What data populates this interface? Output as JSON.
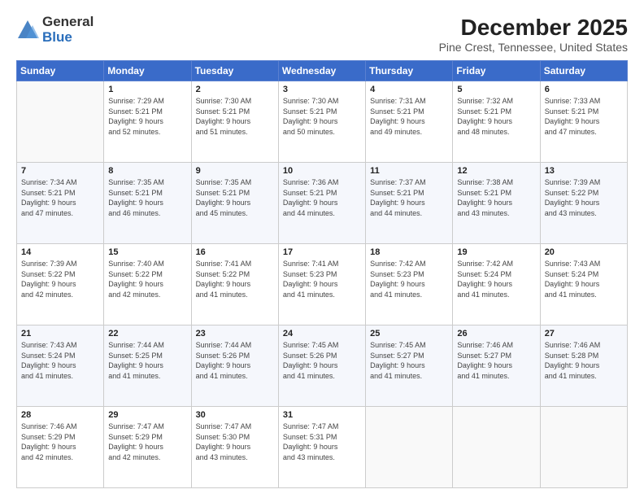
{
  "logo": {
    "general": "General",
    "blue": "Blue"
  },
  "title": "December 2025",
  "subtitle": "Pine Crest, Tennessee, United States",
  "headers": [
    "Sunday",
    "Monday",
    "Tuesday",
    "Wednesday",
    "Thursday",
    "Friday",
    "Saturday"
  ],
  "weeks": [
    [
      {
        "day": "",
        "info": ""
      },
      {
        "day": "1",
        "info": "Sunrise: 7:29 AM\nSunset: 5:21 PM\nDaylight: 9 hours\nand 52 minutes."
      },
      {
        "day": "2",
        "info": "Sunrise: 7:30 AM\nSunset: 5:21 PM\nDaylight: 9 hours\nand 51 minutes."
      },
      {
        "day": "3",
        "info": "Sunrise: 7:30 AM\nSunset: 5:21 PM\nDaylight: 9 hours\nand 50 minutes."
      },
      {
        "day": "4",
        "info": "Sunrise: 7:31 AM\nSunset: 5:21 PM\nDaylight: 9 hours\nand 49 minutes."
      },
      {
        "day": "5",
        "info": "Sunrise: 7:32 AM\nSunset: 5:21 PM\nDaylight: 9 hours\nand 48 minutes."
      },
      {
        "day": "6",
        "info": "Sunrise: 7:33 AM\nSunset: 5:21 PM\nDaylight: 9 hours\nand 47 minutes."
      }
    ],
    [
      {
        "day": "7",
        "info": "Sunrise: 7:34 AM\nSunset: 5:21 PM\nDaylight: 9 hours\nand 47 minutes."
      },
      {
        "day": "8",
        "info": "Sunrise: 7:35 AM\nSunset: 5:21 PM\nDaylight: 9 hours\nand 46 minutes."
      },
      {
        "day": "9",
        "info": "Sunrise: 7:35 AM\nSunset: 5:21 PM\nDaylight: 9 hours\nand 45 minutes."
      },
      {
        "day": "10",
        "info": "Sunrise: 7:36 AM\nSunset: 5:21 PM\nDaylight: 9 hours\nand 44 minutes."
      },
      {
        "day": "11",
        "info": "Sunrise: 7:37 AM\nSunset: 5:21 PM\nDaylight: 9 hours\nand 44 minutes."
      },
      {
        "day": "12",
        "info": "Sunrise: 7:38 AM\nSunset: 5:21 PM\nDaylight: 9 hours\nand 43 minutes."
      },
      {
        "day": "13",
        "info": "Sunrise: 7:39 AM\nSunset: 5:22 PM\nDaylight: 9 hours\nand 43 minutes."
      }
    ],
    [
      {
        "day": "14",
        "info": "Sunrise: 7:39 AM\nSunset: 5:22 PM\nDaylight: 9 hours\nand 42 minutes."
      },
      {
        "day": "15",
        "info": "Sunrise: 7:40 AM\nSunset: 5:22 PM\nDaylight: 9 hours\nand 42 minutes."
      },
      {
        "day": "16",
        "info": "Sunrise: 7:41 AM\nSunset: 5:22 PM\nDaylight: 9 hours\nand 41 minutes."
      },
      {
        "day": "17",
        "info": "Sunrise: 7:41 AM\nSunset: 5:23 PM\nDaylight: 9 hours\nand 41 minutes."
      },
      {
        "day": "18",
        "info": "Sunrise: 7:42 AM\nSunset: 5:23 PM\nDaylight: 9 hours\nand 41 minutes."
      },
      {
        "day": "19",
        "info": "Sunrise: 7:42 AM\nSunset: 5:24 PM\nDaylight: 9 hours\nand 41 minutes."
      },
      {
        "day": "20",
        "info": "Sunrise: 7:43 AM\nSunset: 5:24 PM\nDaylight: 9 hours\nand 41 minutes."
      }
    ],
    [
      {
        "day": "21",
        "info": "Sunrise: 7:43 AM\nSunset: 5:24 PM\nDaylight: 9 hours\nand 41 minutes."
      },
      {
        "day": "22",
        "info": "Sunrise: 7:44 AM\nSunset: 5:25 PM\nDaylight: 9 hours\nand 41 minutes."
      },
      {
        "day": "23",
        "info": "Sunrise: 7:44 AM\nSunset: 5:26 PM\nDaylight: 9 hours\nand 41 minutes."
      },
      {
        "day": "24",
        "info": "Sunrise: 7:45 AM\nSunset: 5:26 PM\nDaylight: 9 hours\nand 41 minutes."
      },
      {
        "day": "25",
        "info": "Sunrise: 7:45 AM\nSunset: 5:27 PM\nDaylight: 9 hours\nand 41 minutes."
      },
      {
        "day": "26",
        "info": "Sunrise: 7:46 AM\nSunset: 5:27 PM\nDaylight: 9 hours\nand 41 minutes."
      },
      {
        "day": "27",
        "info": "Sunrise: 7:46 AM\nSunset: 5:28 PM\nDaylight: 9 hours\nand 41 minutes."
      }
    ],
    [
      {
        "day": "28",
        "info": "Sunrise: 7:46 AM\nSunset: 5:29 PM\nDaylight: 9 hours\nand 42 minutes."
      },
      {
        "day": "29",
        "info": "Sunrise: 7:47 AM\nSunset: 5:29 PM\nDaylight: 9 hours\nand 42 minutes."
      },
      {
        "day": "30",
        "info": "Sunrise: 7:47 AM\nSunset: 5:30 PM\nDaylight: 9 hours\nand 43 minutes."
      },
      {
        "day": "31",
        "info": "Sunrise: 7:47 AM\nSunset: 5:31 PM\nDaylight: 9 hours\nand 43 minutes."
      },
      {
        "day": "",
        "info": ""
      },
      {
        "day": "",
        "info": ""
      },
      {
        "day": "",
        "info": ""
      }
    ]
  ]
}
